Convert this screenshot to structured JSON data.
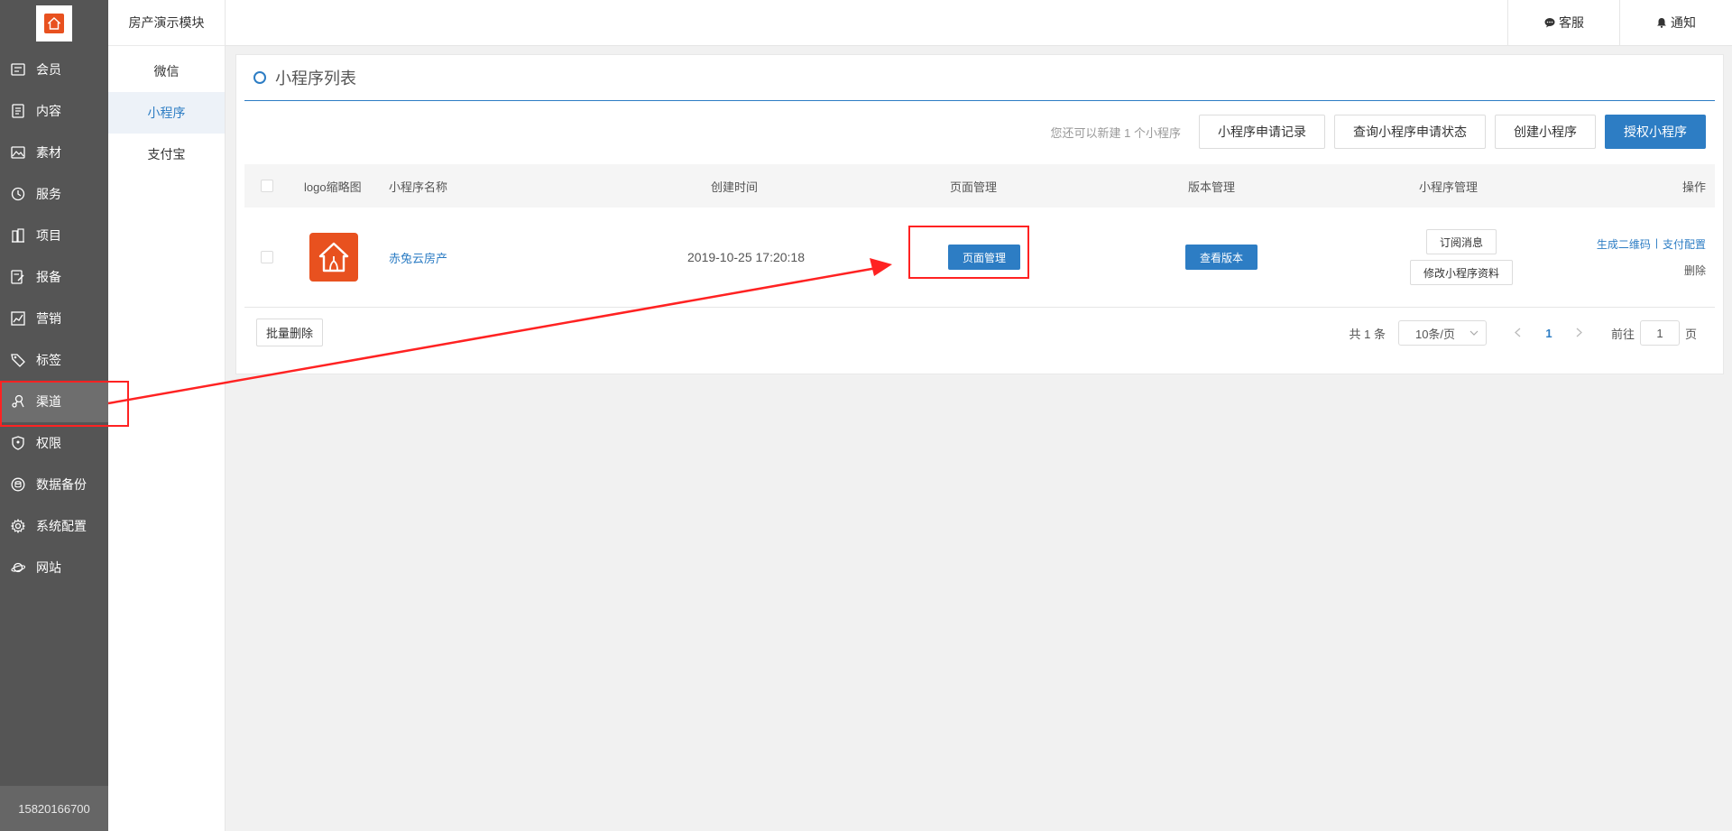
{
  "sidebar": {
    "items": [
      {
        "label": "会员",
        "icon": "member-card-icon"
      },
      {
        "label": "内容",
        "icon": "document-icon"
      },
      {
        "label": "素材",
        "icon": "image-icon"
      },
      {
        "label": "服务",
        "icon": "clock-icon"
      },
      {
        "label": "项目",
        "icon": "building-icon"
      },
      {
        "label": "报备",
        "icon": "edit-doc-icon"
      },
      {
        "label": "营销",
        "icon": "chart-icon"
      },
      {
        "label": "标签",
        "icon": "tag-icon"
      },
      {
        "label": "渠道",
        "icon": "channel-icon"
      },
      {
        "label": "权限",
        "icon": "shield-icon"
      },
      {
        "label": "数据备份",
        "icon": "database-icon"
      },
      {
        "label": "系统配置",
        "icon": "gear-icon"
      },
      {
        "label": "网站",
        "icon": "planet-icon"
      }
    ],
    "active_index": 8,
    "user_phone": "15820166700"
  },
  "subside": {
    "title": "房产演示模块",
    "items": [
      "微信",
      "小程序",
      "支付宝"
    ],
    "active_index": 1
  },
  "topbar": {
    "service_label": "客服",
    "notice_label": "通知"
  },
  "panel": {
    "title": "小程序列表",
    "toolbar": {
      "note": "您还可以新建 1 个小程序",
      "btn_records": "小程序申请记录",
      "btn_query": "查询小程序申请状态",
      "btn_create": "创建小程序",
      "btn_auth": "授权小程序"
    },
    "columns": [
      "logo缩略图",
      "小程序名称",
      "创建时间",
      "页面管理",
      "版本管理",
      "小程序管理",
      "操作"
    ],
    "rows": [
      {
        "name": "赤兔云房产",
        "created": "2019-10-25 17:20:18",
        "page_btn": "页面管理",
        "version_btn": "查看版本",
        "subscribe_btn": "订阅消息",
        "edit_btn": "修改小程序资料",
        "op_qrcode": "生成二维码",
        "op_sep": "|",
        "op_pay": "支付配置",
        "op_delete": "删除"
      }
    ],
    "footer": {
      "batch_delete": "批量删除",
      "total": "共 1 条",
      "page_size": "10条/页",
      "current_page": "1",
      "goto_label": "前往",
      "goto_value": "1",
      "page_unit": "页"
    }
  },
  "colors": {
    "sidebar_bg": "#555555",
    "accent": "#2d7dc4",
    "logo_orange": "#e8511f",
    "annotation_red": "#ff2222"
  }
}
